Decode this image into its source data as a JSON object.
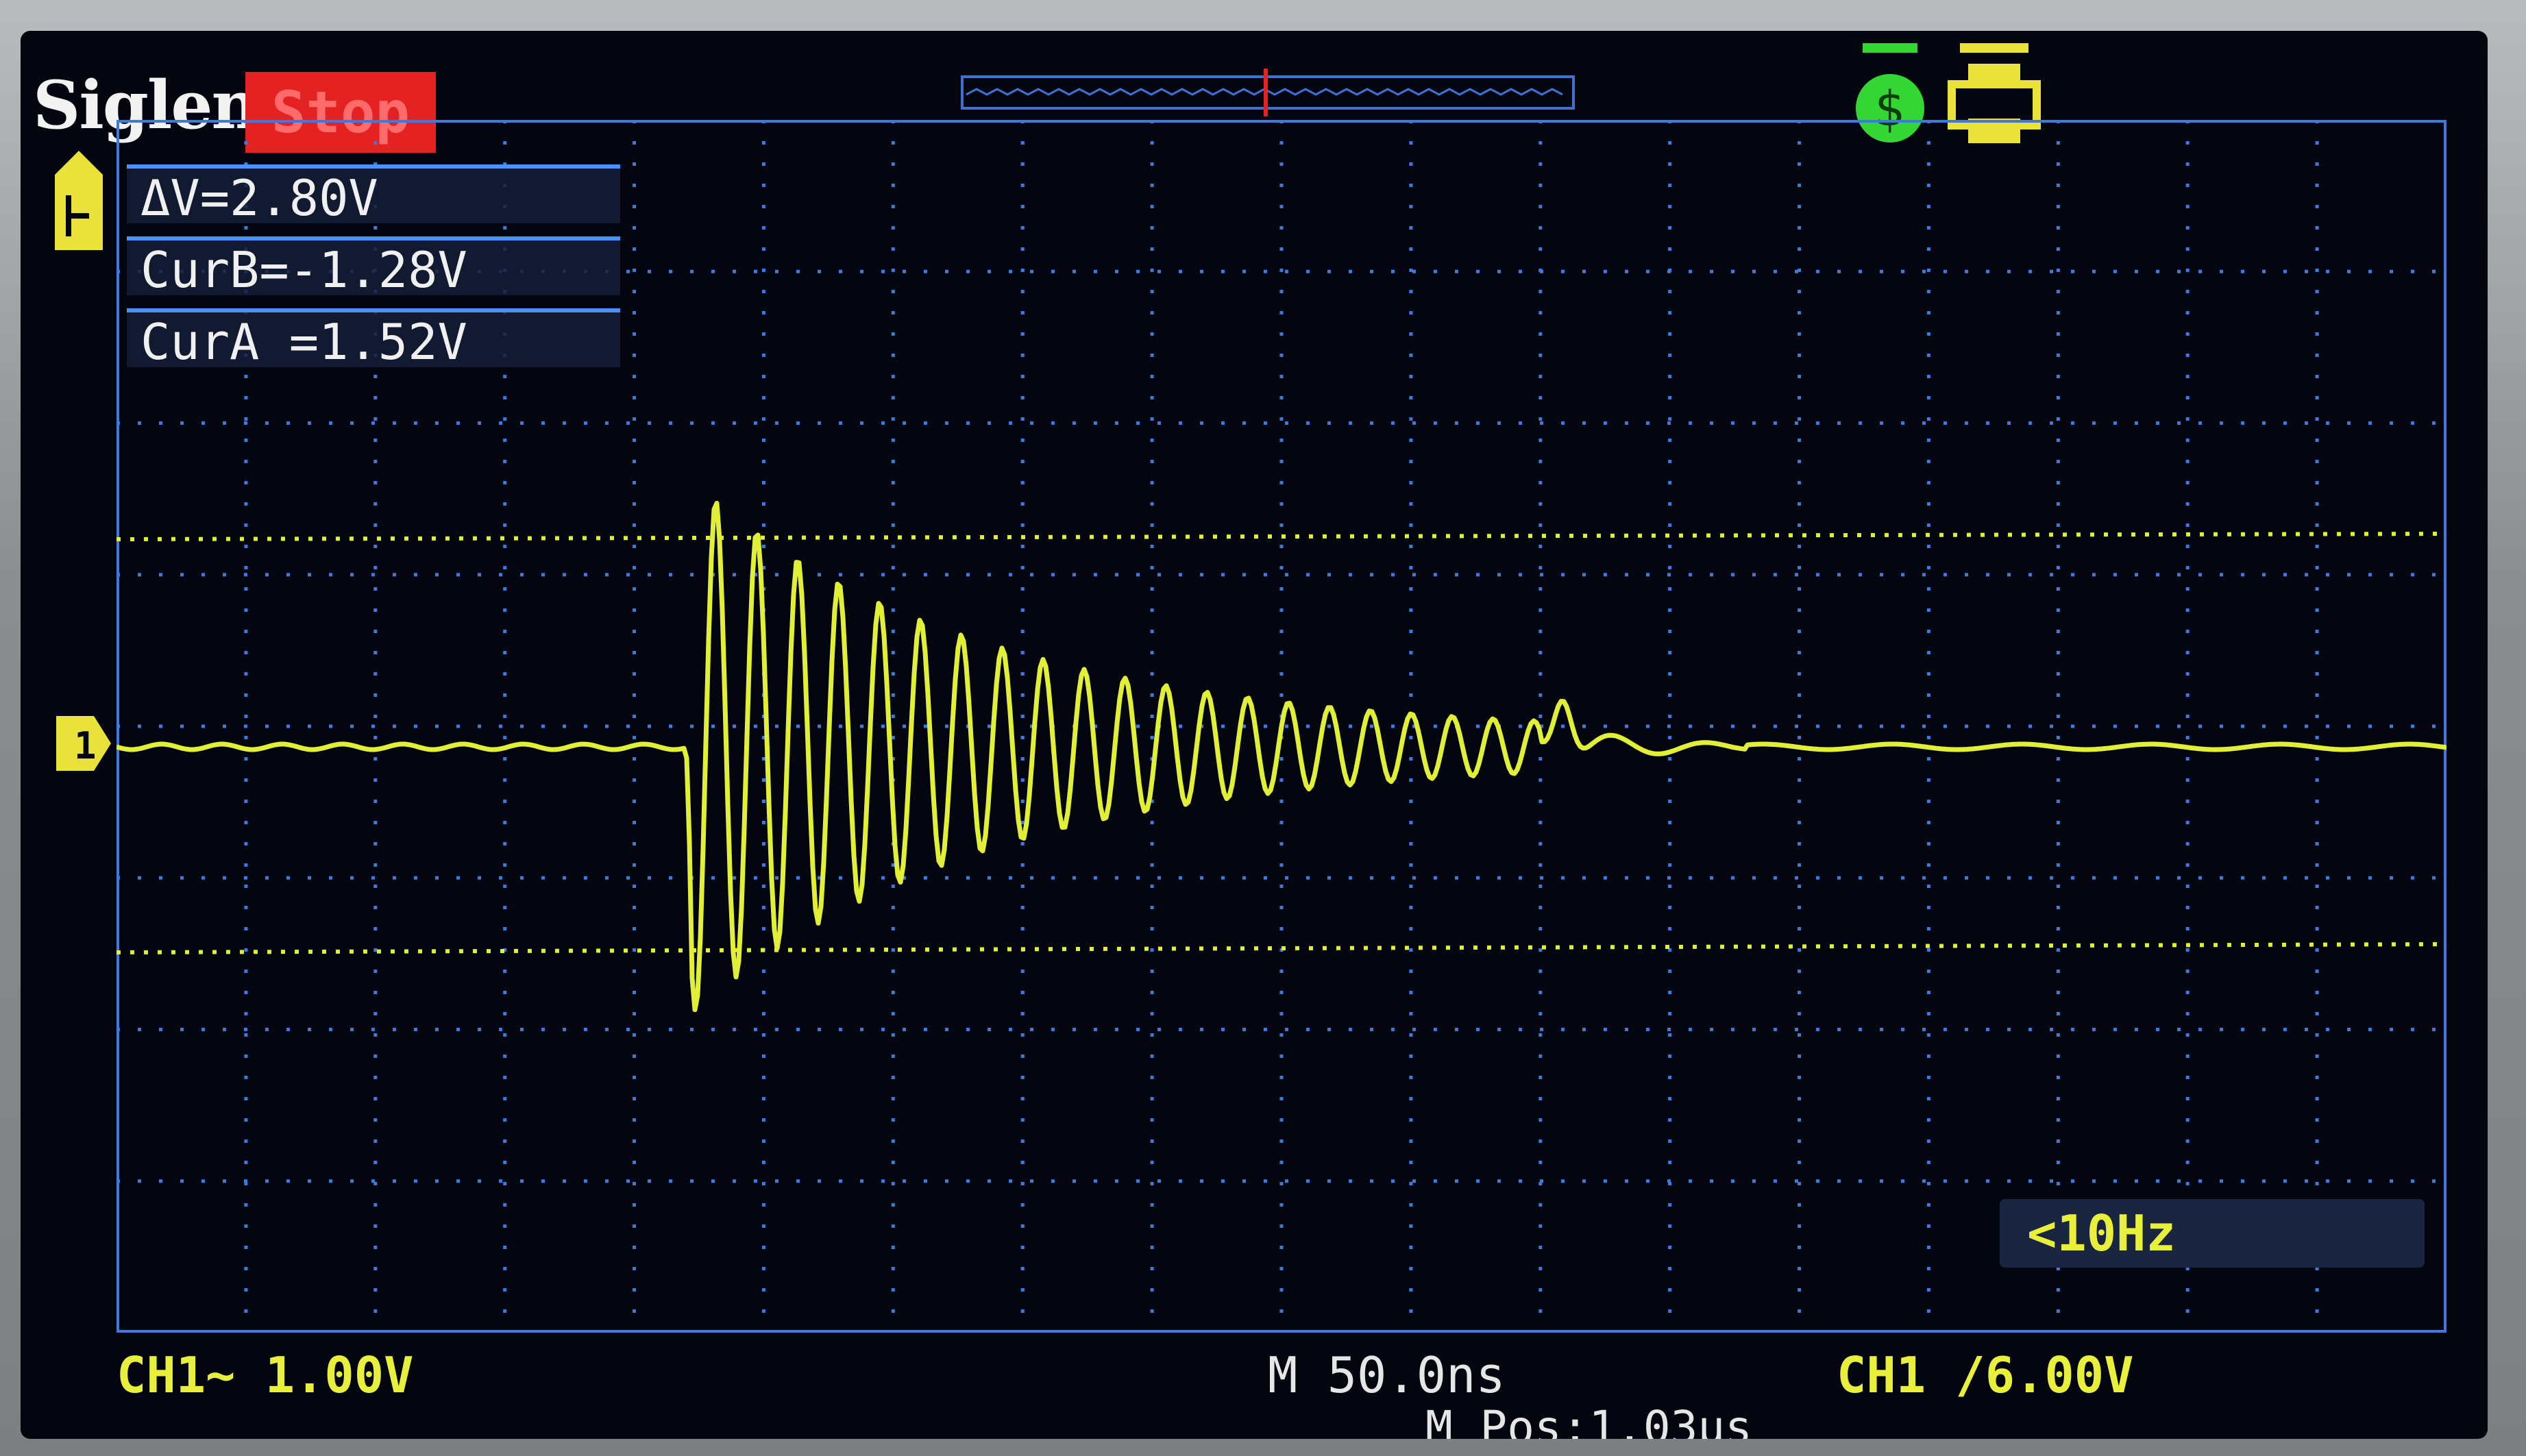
{
  "brand": "Siglent",
  "run_state": "Stop",
  "cursors": {
    "delta": "ΔV=2.80V",
    "cur_b": "CurB=-1.28V",
    "cur_a": "CurA =1.52V"
  },
  "frequency": "<10Hz",
  "status": {
    "ch1_scale": "CH1~ 1.00V",
    "time_scale": "M 50.0ns",
    "position": "M Pos:1.03μs",
    "trigger_level": "CH1 /6.00V"
  },
  "markers": {
    "channel": "1"
  },
  "icons": [
    "trigger-flag-icon",
    "usb-icon",
    "printer-icon",
    "channel-1-marker-icon"
  ],
  "colors": {
    "trace": "#e1ef36",
    "grid": "#3d7ae0",
    "run_state_bg": "#e52222",
    "screen_bg": "#04060f"
  }
}
